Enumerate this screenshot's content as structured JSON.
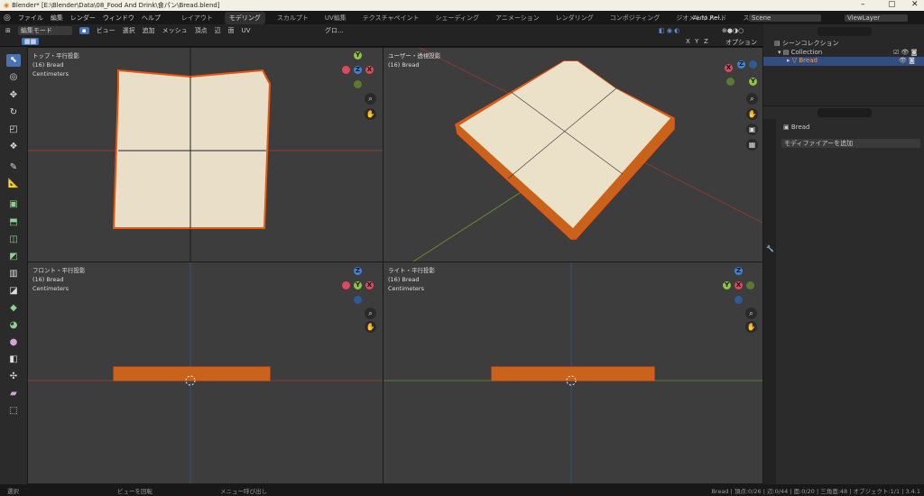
{
  "window": {
    "title": "Blender* [E:\\Blender\\Data\\08_Food And Drink\\食パン\\Bread.blend]",
    "minimize": "–",
    "maximize": "▢",
    "close": "✕"
  },
  "menu": [
    "ファイル",
    "編集",
    "レンダー",
    "ウィンドウ",
    "ヘルプ"
  ],
  "workspaces": [
    "レイアウト",
    "モデリング",
    "スカルプト",
    "UV編集",
    "テクスチャペイント",
    "シェーディング",
    "アニメーション",
    "レンダリング",
    "コンポジティング",
    "ジオメトリノード",
    "スクリプト作成",
    "+"
  ],
  "active_workspace": "モデリング",
  "topright": {
    "auto": "Auto Rel...",
    "scene": "Scene",
    "viewlayer": "ViewLayer"
  },
  "header": {
    "mode": "編集モード",
    "menus": [
      "ビュー",
      "選択",
      "追加",
      "メッシュ",
      "頂点",
      "辺",
      "面",
      "UV"
    ],
    "transform": "グロ...",
    "axes": [
      "X",
      "Y",
      "Z"
    ],
    "options": "オプション"
  },
  "viewports": [
    {
      "title": "トップ・平行投影",
      "object": "(16) Bread",
      "units": "Centimeters"
    },
    {
      "title": "ユーザー・透視投影",
      "object": "(16) Bread",
      "units": ""
    },
    {
      "title": "フロント・平行投影",
      "object": "(16) Bread",
      "units": "Centimeters"
    },
    {
      "title": "ライト・平行投影",
      "object": "(16) Bread",
      "units": "Centimeters"
    }
  ],
  "outliner": {
    "scene_collection": "シーンコレクション",
    "collection": "Collection",
    "object": "Bread"
  },
  "properties": {
    "object": "Bread",
    "add_modifier": "モディファイアーを追加"
  },
  "status": {
    "left": [
      "選択",
      "ビューを回転",
      "メニュー呼び出し"
    ],
    "right": "Bread | 頂点:0/26 | 辺:0/44 | 面:0/20 | 三角面:48 | オブジェクト:1/1 | 3.4.1"
  }
}
